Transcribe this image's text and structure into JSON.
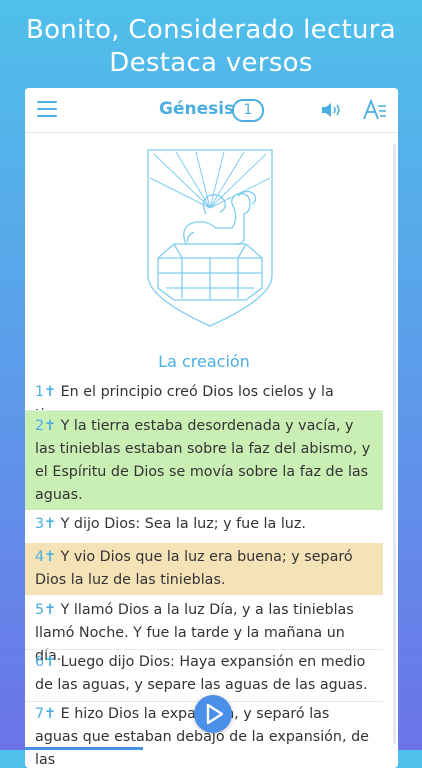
{
  "promo": {
    "line1": "Bonito, Considerado lectura",
    "line2": "Destaca versos"
  },
  "toolbar": {
    "book": "Génesis",
    "chapter": "1",
    "menu_icon": "hamburger-menu-icon",
    "speaker_icon": "speaker-icon",
    "font_icon": "font-size-icon"
  },
  "chapter": {
    "section_title": "La creación",
    "verses": [
      {
        "num": "1✝",
        "text": "En el principio creó Dios los cielos y la tierra.",
        "highlight": "none"
      },
      {
        "num": "2✝",
        "text": "Y la tierra estaba desordenada y vacía, y las tinieblas estaban sobre la faz del abismo, y el Espíritu de Dios se movía sobre la faz de las aguas.",
        "highlight": "#c9efb5"
      },
      {
        "num": "3✝",
        "text": "Y dijo Dios: Sea la luz; y fue la luz.",
        "highlight": "none"
      },
      {
        "num": "4✝",
        "text": "Y vio Dios que la luz era buena; y separó Dios la luz de las tinieblas.",
        "highlight": "#f5e3b8"
      },
      {
        "num": "5✝",
        "text": "Y llamó Dios a la luz Día, y a las tinieblas llamó Noche. Y fue la tarde y la mañana un día.",
        "highlight": "none"
      },
      {
        "num": "6✝",
        "text": "Luego dijo Dios: Haya expansión en medio de las aguas, y separe las aguas de las aguas.",
        "highlight": "none"
      },
      {
        "num": "7✝",
        "text": "E hizo Dios la expansión, y separó las aguas que estaban debajo de la expansión, de las",
        "highlight": "none"
      }
    ]
  },
  "player": {
    "play_icon": "play-icon",
    "progress": 0.32
  },
  "colors": {
    "accent": "#4aaee0",
    "play": "#4a90e8"
  }
}
